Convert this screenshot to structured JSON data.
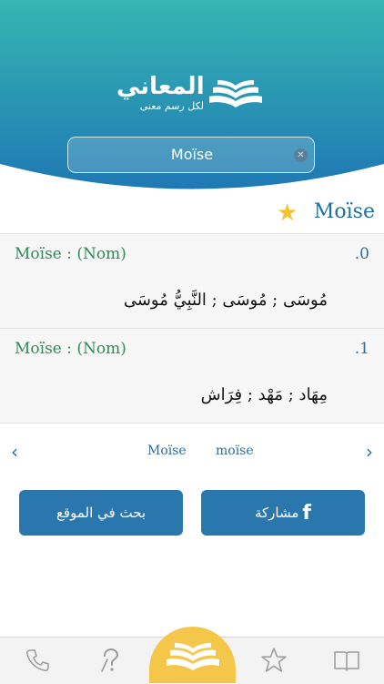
{
  "header": {
    "logo_title": "المعاني",
    "logo_subtitle": "لكل رسم معنى",
    "search_value": "Moïse",
    "colors": {
      "top": "#35b6b2",
      "bottom": "#1f78b4"
    }
  },
  "word": {
    "title": "Moïse",
    "favorite_icon": "star-filled-icon"
  },
  "entries": [
    {
      "head": "Moïse : (Nom)",
      "number": ".0",
      "translation": "مُوسَى ; مُوسَى ; النَّبِيُّ مُوسَى"
    },
    {
      "head": "Moïse : (Nom)",
      "number": ".1",
      "translation": "مِهَاد ; مَهْد ; فِرَاش"
    }
  ],
  "pager": {
    "prev_icon": "chevron-left-icon",
    "next_icon": "chevron-right-icon",
    "word1": "Moïse",
    "word2": "moïse"
  },
  "buttons": {
    "search_site": "بحث في الموقع",
    "share": "مشاركة",
    "share_icon": "facebook-icon"
  },
  "tabbar": {
    "items": [
      "phone-icon",
      "question-icon",
      "book-open-icon",
      "star-outline-icon",
      "dictionary-icon"
    ],
    "accent": "#f4c74a"
  }
}
